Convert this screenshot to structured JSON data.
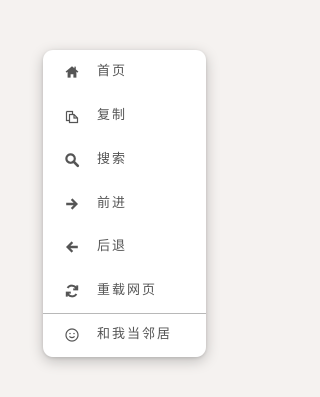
{
  "menu": {
    "items": [
      {
        "label": "首页",
        "icon": "home-icon"
      },
      {
        "label": "复制",
        "icon": "copy-icon"
      },
      {
        "label": "搜索",
        "icon": "search-icon"
      },
      {
        "label": "前进",
        "icon": "arrow-right-icon"
      },
      {
        "label": "后退",
        "icon": "arrow-left-icon"
      },
      {
        "label": "重载网页",
        "icon": "reload-icon"
      }
    ],
    "footer_item": {
      "label": "和我当邻居",
      "icon": "smiley-icon"
    }
  },
  "colors": {
    "background": "#f5f2f0",
    "menu_background": "#ffffff",
    "icon": "#555555",
    "text": "#555555",
    "divider": "#b8b8b8"
  }
}
